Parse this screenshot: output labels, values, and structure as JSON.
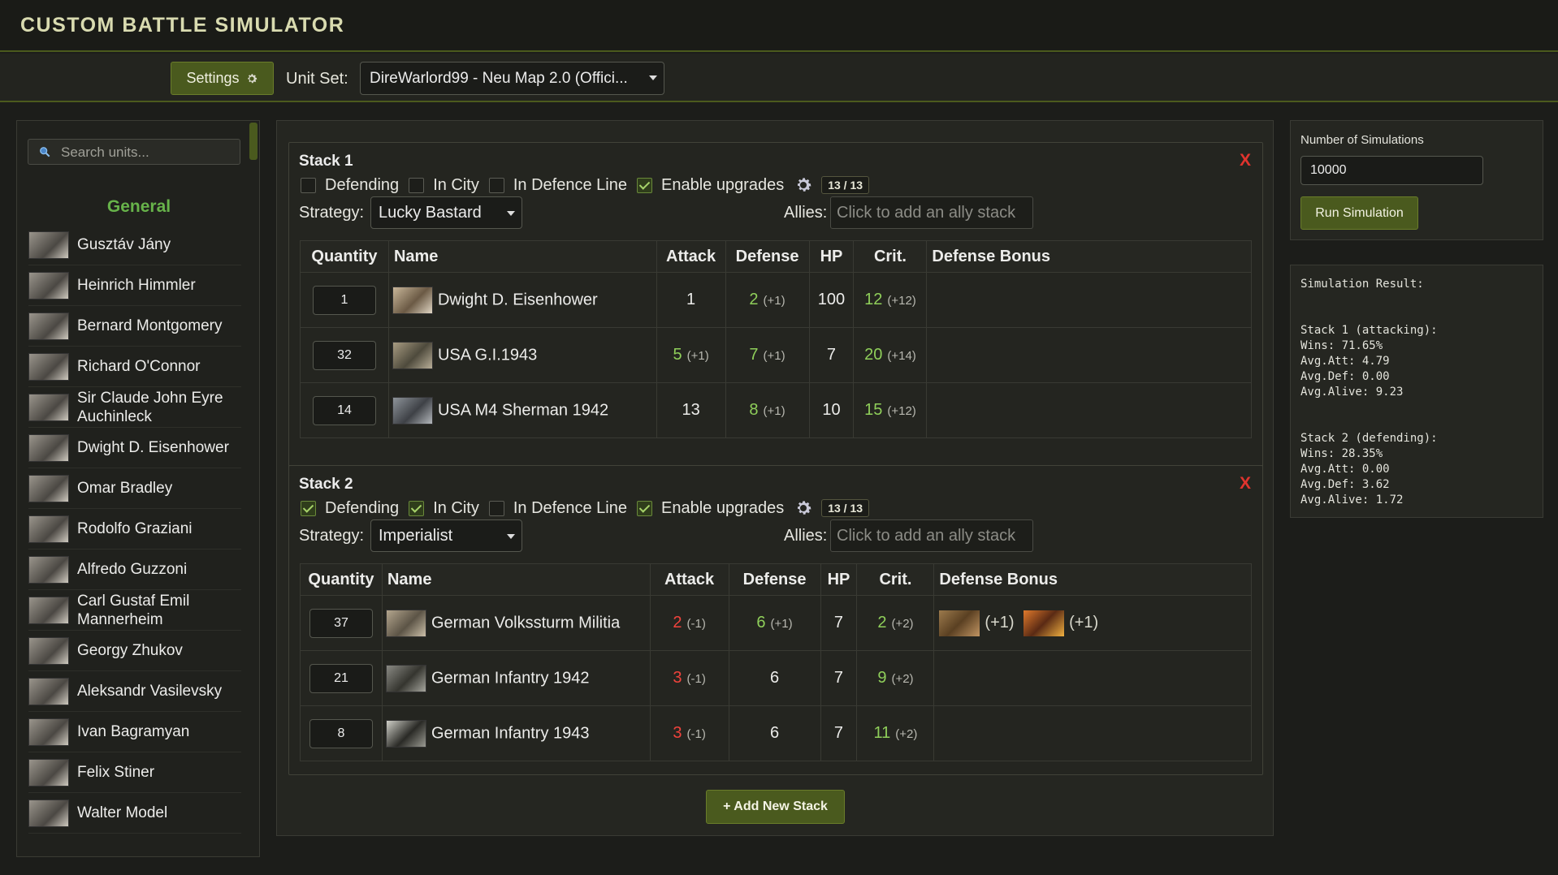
{
  "app": {
    "title": "CUSTOM BATTLE SIMULATOR"
  },
  "toolbar": {
    "settings_label": "Settings",
    "unit_set_label": "Unit Set:",
    "unit_set_value": "DireWarlord99 - Neu Map 2.0 (Offici..."
  },
  "sidebar": {
    "search_placeholder": "Search units...",
    "section_title": "General",
    "items": [
      "Gusztáv Jány",
      "Heinrich Himmler",
      "Bernard Montgomery",
      "Richard O'Connor",
      "Sir Claude John Eyre Auchinleck",
      "Dwight D. Eisenhower",
      "Omar Bradley",
      "Rodolfo Graziani",
      "Alfredo Guzzoni",
      "Carl Gustaf Emil Mannerheim",
      "Georgy Zhukov",
      "Aleksandr Vasilevsky",
      "Ivan Bagramyan",
      "Felix Stiner",
      "Walter Model"
    ]
  },
  "columns": {
    "quantity": "Quantity",
    "name": "Name",
    "attack": "Attack",
    "defense": "Defense",
    "hp": "HP",
    "crit": "Crit.",
    "defense_bonus": "Defense Bonus"
  },
  "labels": {
    "defending": "Defending",
    "in_city": "In City",
    "in_defence_line": "In Defence Line",
    "enable_upgrades": "Enable upgrades",
    "strategy": "Strategy:",
    "allies": "Allies:",
    "allies_placeholder": "Click to add an ally stack",
    "close": "X"
  },
  "stacks": [
    {
      "title": "Stack 1",
      "defending": false,
      "in_city": false,
      "in_defence_line": false,
      "enable_upgrades": true,
      "upgrades_badge": "13 / 13",
      "strategy": "Lucky Bastard",
      "units": [
        {
          "qty": "1",
          "name": "Dwight D. Eisenhower",
          "attack": "1",
          "attack_mod": "",
          "attack_color": "plain",
          "defense": "2",
          "defense_mod": "(+1)",
          "defense_color": "pos",
          "hp": "100",
          "crit": "12",
          "crit_mod": "(+12)",
          "thumb": "#8a7d6a"
        },
        {
          "qty": "32",
          "name": "USA G.I.1943",
          "attack": "5",
          "attack_mod": "(+1)",
          "attack_color": "pos",
          "defense": "7",
          "defense_mod": "(+1)",
          "defense_color": "pos",
          "hp": "7",
          "crit": "20",
          "crit_mod": "(+14)",
          "thumb": "#7a6e58"
        },
        {
          "qty": "14",
          "name": "USA M4 Sherman 1942",
          "attack": "13",
          "attack_mod": "",
          "attack_color": "plain",
          "defense": "8",
          "defense_mod": "(+1)",
          "defense_color": "pos",
          "hp": "10",
          "crit": "15",
          "crit_mod": "(+12)",
          "thumb": "#6c6f72"
        }
      ]
    },
    {
      "title": "Stack 2",
      "defending": true,
      "in_city": true,
      "in_defence_line": false,
      "enable_upgrades": true,
      "upgrades_badge": "13 / 13",
      "strategy": "Imperialist",
      "units": [
        {
          "qty": "37",
          "name": "German Volkssturm Militia",
          "attack": "2",
          "attack_mod": "(-1)",
          "attack_color": "neg",
          "defense": "6",
          "defense_mod": "(+1)",
          "defense_color": "pos",
          "hp": "7",
          "crit": "2",
          "crit_mod": "(+2)",
          "thumb": "#85786a",
          "bonus": [
            "(+1)",
            "(+1)"
          ]
        },
        {
          "qty": "21",
          "name": "German Infantry 1942",
          "attack": "3",
          "attack_mod": "(-1)",
          "attack_color": "neg",
          "defense": "6",
          "defense_mod": "",
          "defense_color": "plain",
          "hp": "7",
          "crit": "9",
          "crit_mod": "(+2)",
          "thumb": "#6e6e6a"
        },
        {
          "qty": "8",
          "name": "German Infantry 1943",
          "attack": "3",
          "attack_mod": "(-1)",
          "attack_color": "neg",
          "defense": "6",
          "defense_mod": "",
          "defense_color": "plain",
          "hp": "7",
          "crit": "11",
          "crit_mod": "(+2)",
          "thumb": "#5f5f5b"
        }
      ]
    }
  ],
  "add_stack_label": "+ Add New Stack",
  "simulation": {
    "label": "Number of Simulations",
    "value": "10000",
    "run_label": "Run Simulation",
    "result_text": "Simulation Result:\n\n\nStack 1 (attacking):\nWins: 71.65%\nAvg.Att: 4.79\nAvg.Def: 0.00\nAvg.Alive: 9.23\n\n\nStack 2 (defending):\nWins: 28.35%\nAvg.Att: 0.00\nAvg.Def: 3.62\nAvg.Alive: 1.72"
  },
  "colors": {
    "accent": "#4a5a1e",
    "positive": "#8fcf5a",
    "negative": "#f0433c",
    "close": "#e0342e",
    "section": "#67b34a"
  }
}
